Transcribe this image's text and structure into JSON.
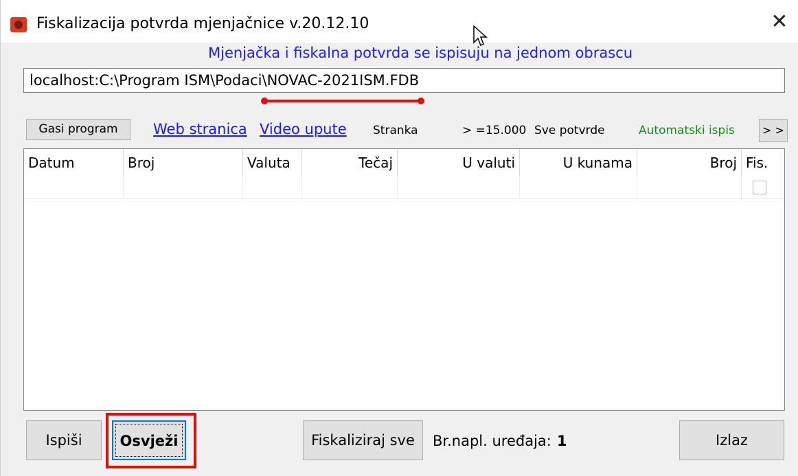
{
  "window": {
    "title": "Fiskalizacija potvrda mjenjačnice v.20.12.10",
    "close_label": "✕"
  },
  "notice": "Mjenjačka i fiskalna potvrda se ispisuju na jednom obrascu",
  "database_path": "localhost:C:\\Program ISM\\Podaci\\NOVAC-2021ISM.FDB",
  "toolbar": {
    "gasi_program": "Gasi program",
    "web_stranica": "Web stranica",
    "video_upute": "Video upute",
    "stranka": "Stranka",
    "threshold": "> =15.000",
    "sve_potvrde": "Sve potvrde",
    "automatski_ispis": "Automatski ispis",
    "more": "> >"
  },
  "table": {
    "columns": [
      "Datum",
      "Broj",
      "Valuta",
      "Tečaj",
      "U valuti",
      "U kunama",
      "Broj",
      "Fis."
    ],
    "rows": []
  },
  "footer": {
    "ispisi": "Ispiši",
    "osvjezi": "Osvježi",
    "fiskaliziraj_sve": "Fiskaliziraj sve",
    "br_napl_label": "Br.napl. uređaja:",
    "br_napl_value": "1",
    "izlaz": "Izlaz"
  },
  "colors": {
    "notice_blue": "#2020ff",
    "link_blue": "#1a1aff",
    "green_label": "#1c8a1c",
    "highlight_red": "#e01010"
  },
  "icons": [
    "app-icon",
    "close-icon",
    "mouse-cursor-icon"
  ]
}
